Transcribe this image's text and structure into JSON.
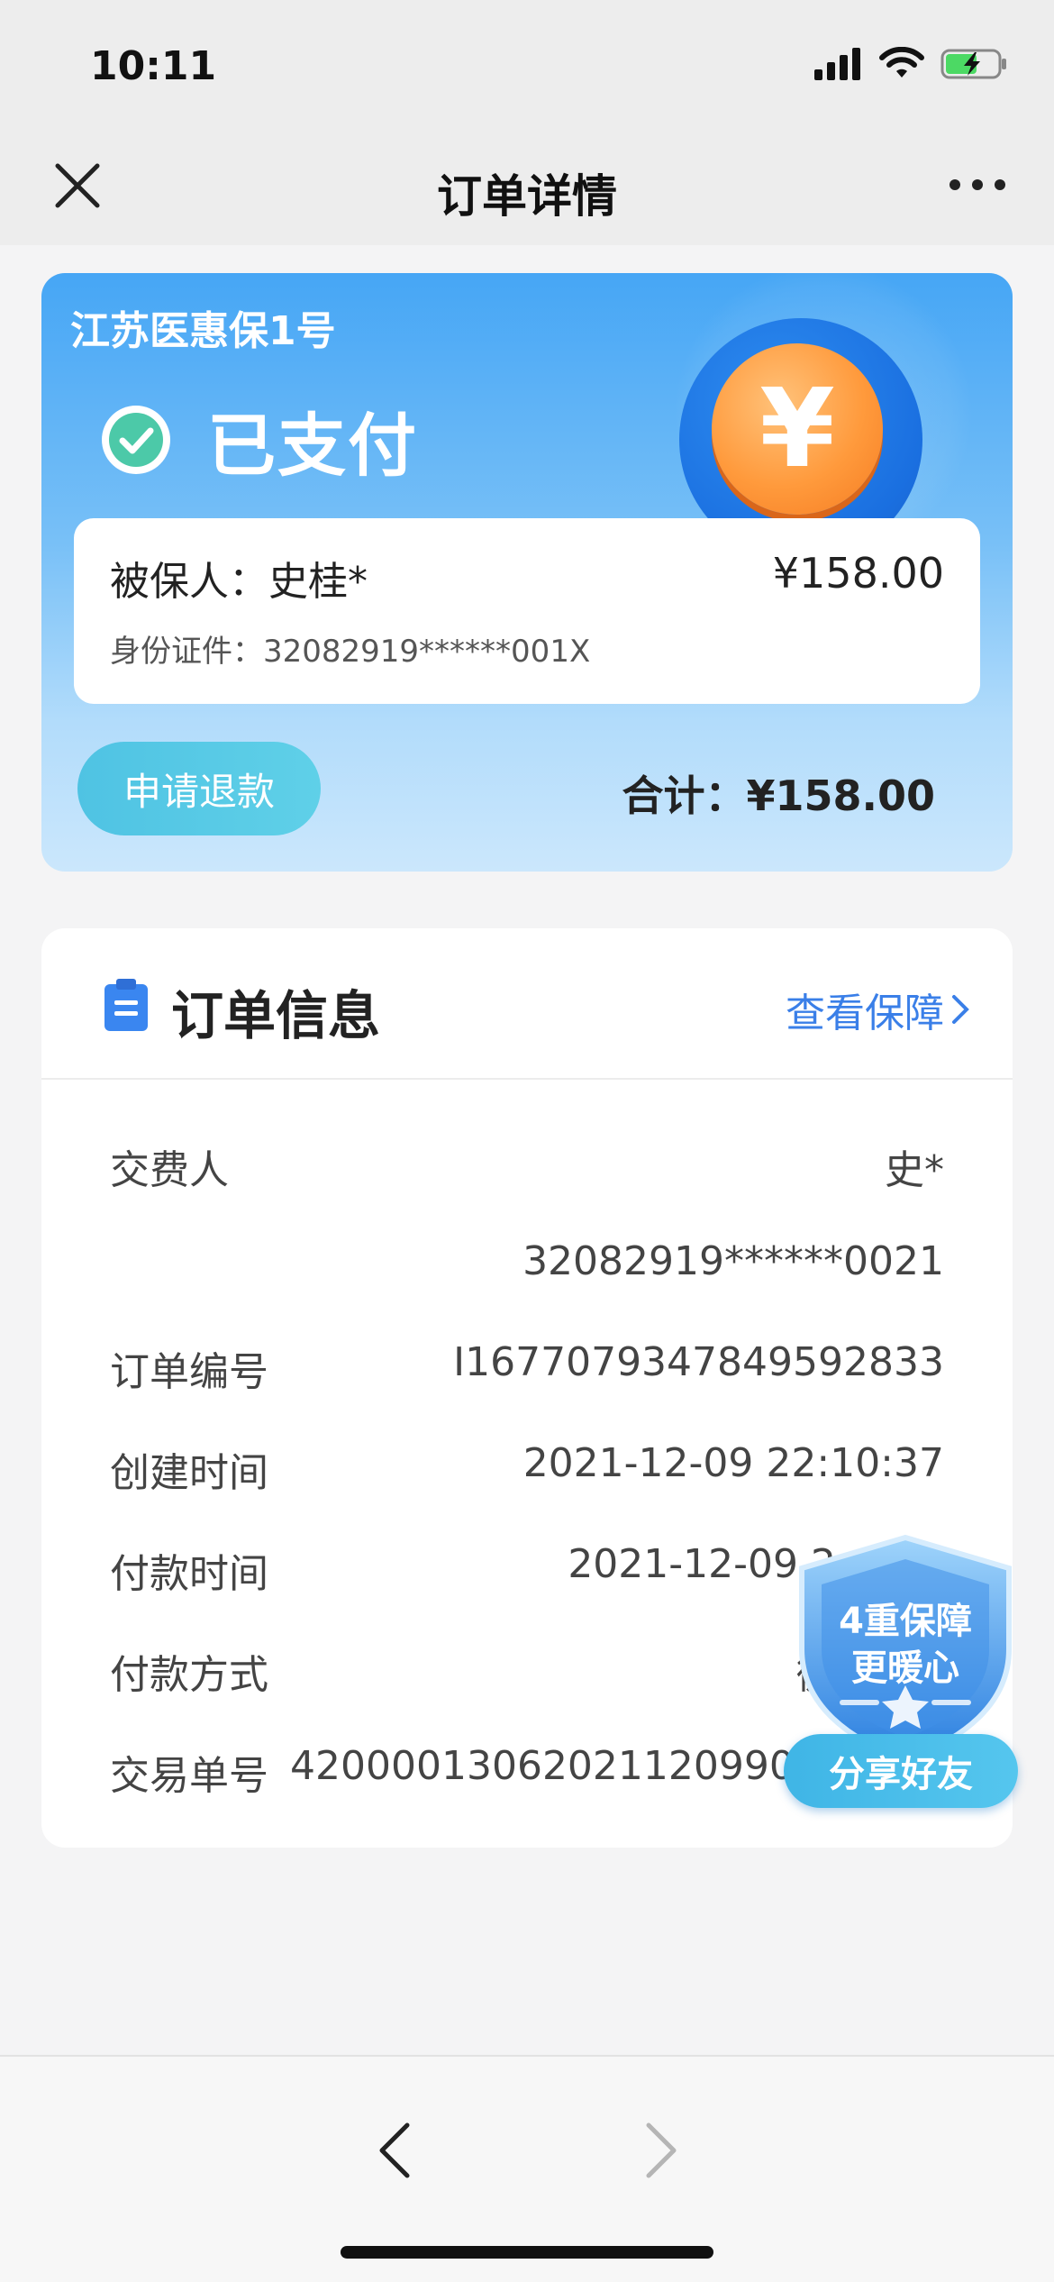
{
  "status_bar": {
    "time": "10:11"
  },
  "nav": {
    "title": "订单详情"
  },
  "order_card": {
    "product_name": "江苏医惠保1号",
    "status": "已支付",
    "coin_symbol": "¥",
    "insured_label": "被保人：史桂*",
    "insured_price": "¥158.00",
    "insured_id": "身份证件：32082919******001X",
    "refund_button": "申请退款",
    "total": "合计：¥158.00"
  },
  "order_info": {
    "title": "订单信息",
    "view_guarantee": "查看保障",
    "rows": [
      {
        "key": "交费人",
        "value": "史*"
      },
      {
        "key": "",
        "value": "32082919******0021"
      },
      {
        "key": "订单编号",
        "value": "I1677079347849592833"
      },
      {
        "key": "创建时间",
        "value": "2021-12-09 22:10:37"
      },
      {
        "key": "付款时间",
        "value": "2021-12-09 2"
      },
      {
        "key": "付款方式",
        "value": "微"
      },
      {
        "key": "交易单号",
        "value": "42000013062021120990526"
      }
    ]
  },
  "badge": {
    "line1": "4重保障",
    "line2": "更暖心",
    "share": "分享好友"
  },
  "colors": {
    "accent_blue": "#3a7fe8",
    "card_gradient_top": "#46a6f5",
    "refund_button": "#4fc3e3",
    "coin_orange": "#ff9a3c"
  }
}
